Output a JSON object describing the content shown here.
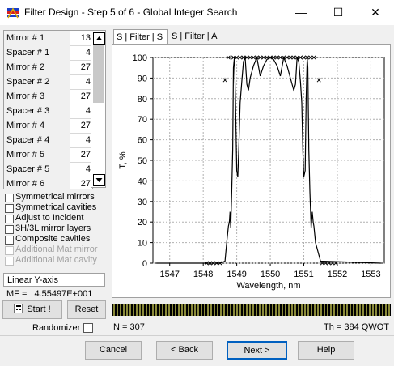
{
  "window": {
    "title": "Filter Design - Step 5 of 6 - Global Integer Search",
    "minimize": "—",
    "maximize": "☐",
    "close": "✕"
  },
  "layers": [
    {
      "name": "Mirror # 1",
      "value": "13"
    },
    {
      "name": "Spacer # 1",
      "value": "4"
    },
    {
      "name": "Mirror # 2",
      "value": "27"
    },
    {
      "name": "Spacer # 2",
      "value": "4"
    },
    {
      "name": "Mirror # 3",
      "value": "27"
    },
    {
      "name": "Spacer # 3",
      "value": "4"
    },
    {
      "name": "Mirror # 4",
      "value": "27"
    },
    {
      "name": "Spacer # 4",
      "value": "4"
    },
    {
      "name": "Mirror # 5",
      "value": "27"
    },
    {
      "name": "Spacer # 5",
      "value": "4"
    },
    {
      "name": "Mirror # 6",
      "value": "27"
    }
  ],
  "options": [
    {
      "label": "Symmetrical mirrors",
      "enabled": true
    },
    {
      "label": "Symmetrical cavities",
      "enabled": true
    },
    {
      "label": "Adjust to Incident",
      "enabled": true
    },
    {
      "label": "3H/3L mirror layers",
      "enabled": true
    },
    {
      "label": "Composite cavities",
      "enabled": true
    },
    {
      "label": "Additional Mat mirror",
      "enabled": false
    },
    {
      "label": "Additional Mat cavity",
      "enabled": false
    }
  ],
  "axis_mode": "Linear Y-axis",
  "mf_label": "MF =",
  "mf_value": "4.55497E+001",
  "buttons": {
    "start": "Start !",
    "reset": "Reset",
    "cancel": "Cancel",
    "back": "< Back",
    "next": "Next >",
    "help": "Help"
  },
  "randomizer": "Randomizer",
  "tabs": [
    "S | Filter | S",
    "S | Filter | A"
  ],
  "status": {
    "n": "N = 307",
    "th": "Th = 384 QWOT"
  },
  "chart_data": {
    "type": "line",
    "xlabel": "Wavelength, nm",
    "ylabel": "T, %",
    "xlim": [
      1546.5,
      1553.4
    ],
    "ylim": [
      0,
      100
    ],
    "xticks": [
      1547,
      1548,
      1549,
      1550,
      1551,
      1552,
      1553
    ],
    "yticks": [
      0,
      10,
      20,
      30,
      40,
      50,
      60,
      70,
      80,
      90,
      100
    ],
    "grid": true,
    "series": [
      {
        "style": "line",
        "color": "#000000",
        "x": [
          1546.6,
          1548.5,
          1548.65,
          1548.7,
          1548.75,
          1548.78,
          1548.8,
          1548.82,
          1548.85,
          1548.88,
          1548.9,
          1548.93,
          1548.96,
          1549.0,
          1549.03,
          1549.06,
          1549.1,
          1549.15,
          1549.2,
          1549.25,
          1549.3,
          1549.35,
          1549.4,
          1549.5,
          1549.6,
          1549.7,
          1549.8,
          1549.9,
          1550.0,
          1550.1,
          1550.2,
          1550.3,
          1550.4,
          1550.5,
          1550.6,
          1550.7,
          1550.75,
          1550.8,
          1550.85,
          1550.9,
          1550.94,
          1550.97,
          1551.0,
          1551.04,
          1551.07,
          1551.1,
          1551.12,
          1551.15,
          1551.18,
          1551.22,
          1551.25,
          1551.28,
          1551.3,
          1551.35,
          1551.5,
          1553.3
        ],
        "y": [
          0,
          0,
          1,
          10,
          18,
          20,
          25,
          17,
          35,
          55,
          95,
          100,
          80,
          45,
          42,
          55,
          78,
          88,
          98,
          100,
          87,
          84,
          90,
          96,
          100,
          91,
          96,
          99,
          100,
          99,
          96,
          91,
          100,
          96,
          90,
          84,
          87,
          100,
          98,
          88,
          78,
          55,
          42,
          45,
          80,
          100,
          95,
          55,
          35,
          17,
          25,
          20,
          18,
          10,
          1,
          0
        ]
      },
      {
        "style": "markers",
        "marker": "x",
        "x": [
          1548.1,
          1548.2,
          1548.3,
          1548.4,
          1548.5,
          1548.65,
          1548.75,
          1548.9,
          1549.0,
          1549.1,
          1549.2,
          1549.3,
          1549.4,
          1549.5,
          1549.6,
          1549.7,
          1549.8,
          1549.9,
          1550.0,
          1550.1,
          1550.2,
          1550.3,
          1550.4,
          1550.5,
          1550.6,
          1550.7,
          1550.8,
          1550.9,
          1551.0,
          1551.1,
          1551.2,
          1551.3,
          1551.45,
          1551.55,
          1551.65,
          1551.75,
          1551.85,
          1551.95
        ],
        "y": [
          0,
          0,
          0,
          0,
          0,
          89,
          100,
          100,
          100,
          100,
          100,
          100,
          100,
          100,
          100,
          100,
          100,
          100,
          100,
          100,
          100,
          100,
          100,
          100,
          100,
          100,
          100,
          100,
          100,
          100,
          100,
          100,
          89,
          0,
          0,
          0,
          0,
          0
        ]
      }
    ]
  }
}
